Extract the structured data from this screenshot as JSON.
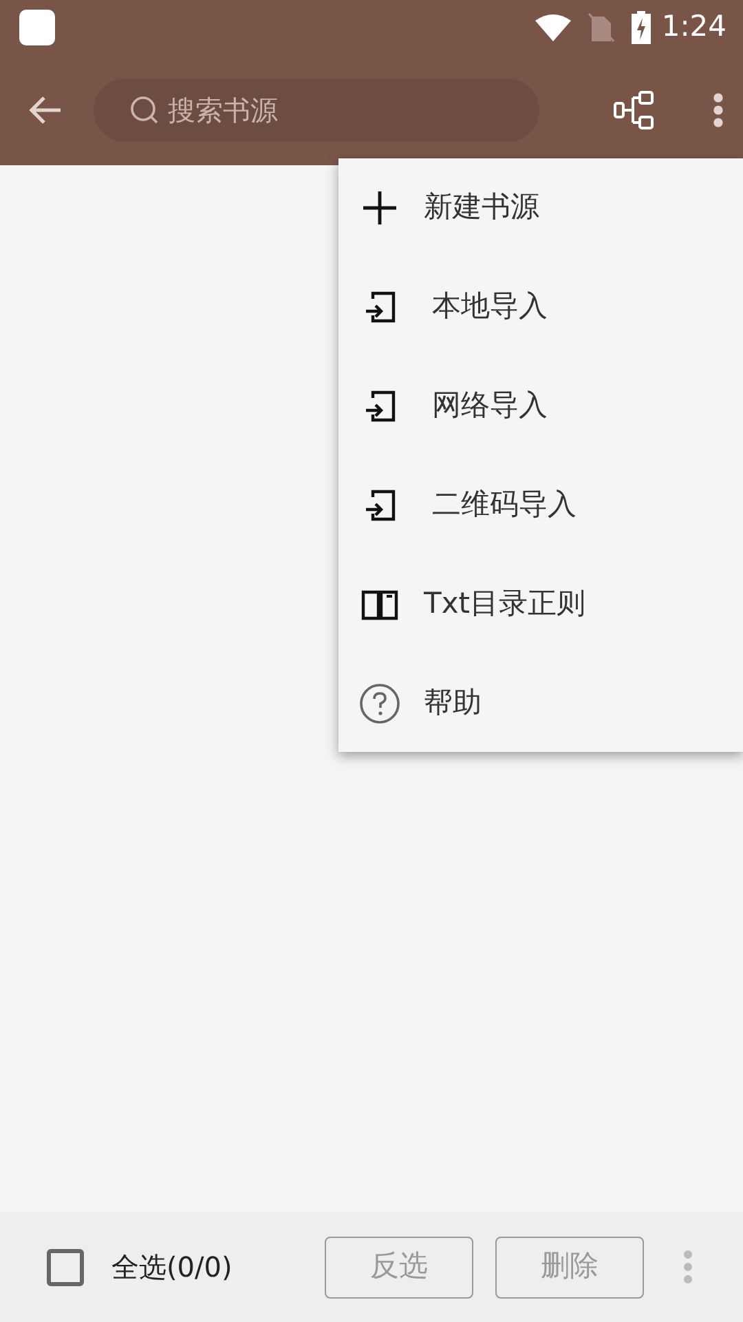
{
  "status_bar": {
    "time": "1:24"
  },
  "toolbar": {
    "search": {
      "placeholder": "搜索书源"
    }
  },
  "menu": [
    {
      "kind": "add",
      "label": "新建书源"
    },
    {
      "kind": "import",
      "label": "本地导入"
    },
    {
      "kind": "import",
      "label": "网络导入"
    },
    {
      "kind": "import",
      "label": "二维码导入"
    },
    {
      "kind": "book",
      "label": "Txt目录正则"
    },
    {
      "kind": "help",
      "label": "帮助"
    }
  ],
  "bottom_bar": {
    "select_all": {
      "label": "全选(0/0)",
      "checked": false
    },
    "buttons": [
      {
        "label": "反选",
        "disabled": true
      },
      {
        "label": "删除",
        "disabled": true
      }
    ]
  }
}
